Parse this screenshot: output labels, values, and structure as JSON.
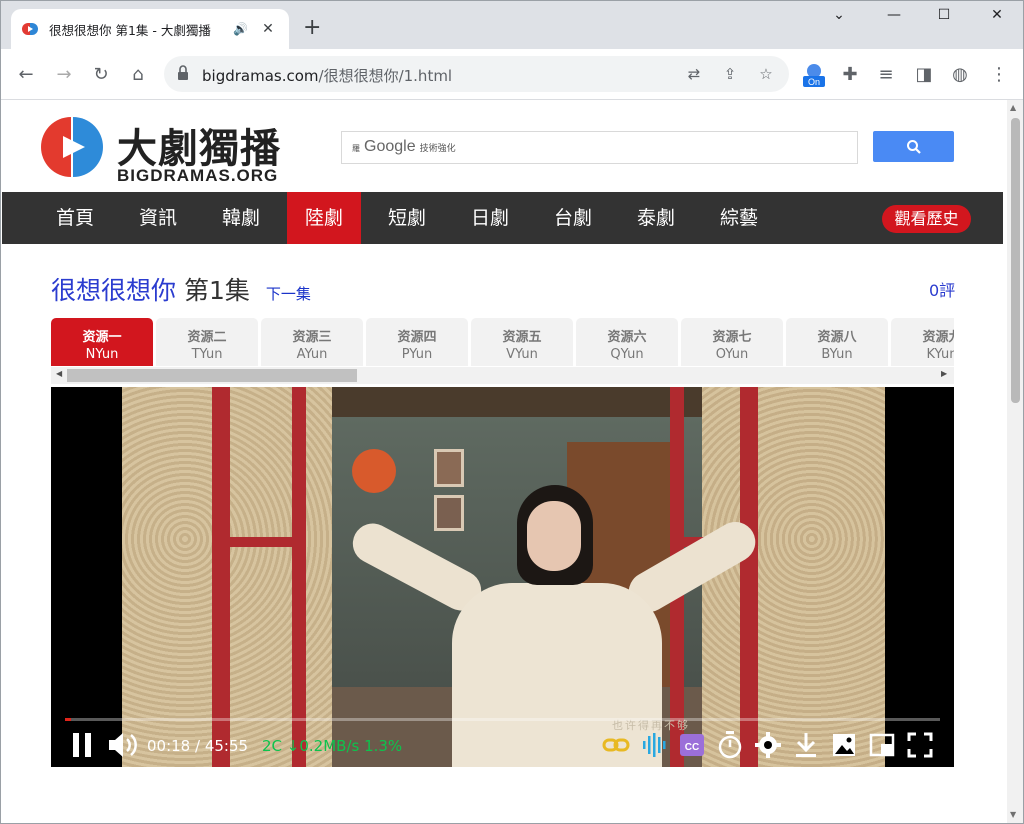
{
  "browser": {
    "tab_title": "很想很想你 第1集 - 大劇獨播",
    "url_host": "bigdramas.com",
    "url_path": "/很想很想你/1.html",
    "extension_badge": "On"
  },
  "site": {
    "logo_cn": "大劇獨播",
    "logo_en": "BIGDRAMAS.ORG",
    "search_brand_prefix": "羅",
    "search_brand": "Google",
    "search_brand_suffix": "技術強化",
    "nav": [
      "首頁",
      "資訊",
      "韓劇",
      "陸劇",
      "短劇",
      "日劇",
      "台劇",
      "泰劇",
      "綜藝"
    ],
    "nav_active": "陸劇",
    "history_label": "觀看歷史"
  },
  "episode": {
    "show": "很想很想你",
    "number": "第1集",
    "next_label": "下一集",
    "comments": "0評"
  },
  "sources": [
    {
      "name": "资源一",
      "code": "NYun",
      "active": true
    },
    {
      "name": "资源二",
      "code": "TYun"
    },
    {
      "name": "资源三",
      "code": "AYun"
    },
    {
      "name": "资源四",
      "code": "PYun"
    },
    {
      "name": "资源五",
      "code": "VYun"
    },
    {
      "name": "资源六",
      "code": "QYun"
    },
    {
      "name": "资源七",
      "code": "OYun"
    },
    {
      "name": "资源八",
      "code": "BYun"
    },
    {
      "name": "资源九",
      "code": "KYun"
    }
  ],
  "player": {
    "time": "00:18 / 45:55",
    "stats": "2C ↓0.2MB/s 1.3%",
    "progress_fraction": 0.007,
    "subtitle": "也许得再不够"
  },
  "colors": {
    "accent_red": "#d2161e",
    "link_blue": "#2b3ccf",
    "nav_bg": "#333333",
    "search_button": "#4a8af4",
    "stats_green": "#0dc34d"
  }
}
